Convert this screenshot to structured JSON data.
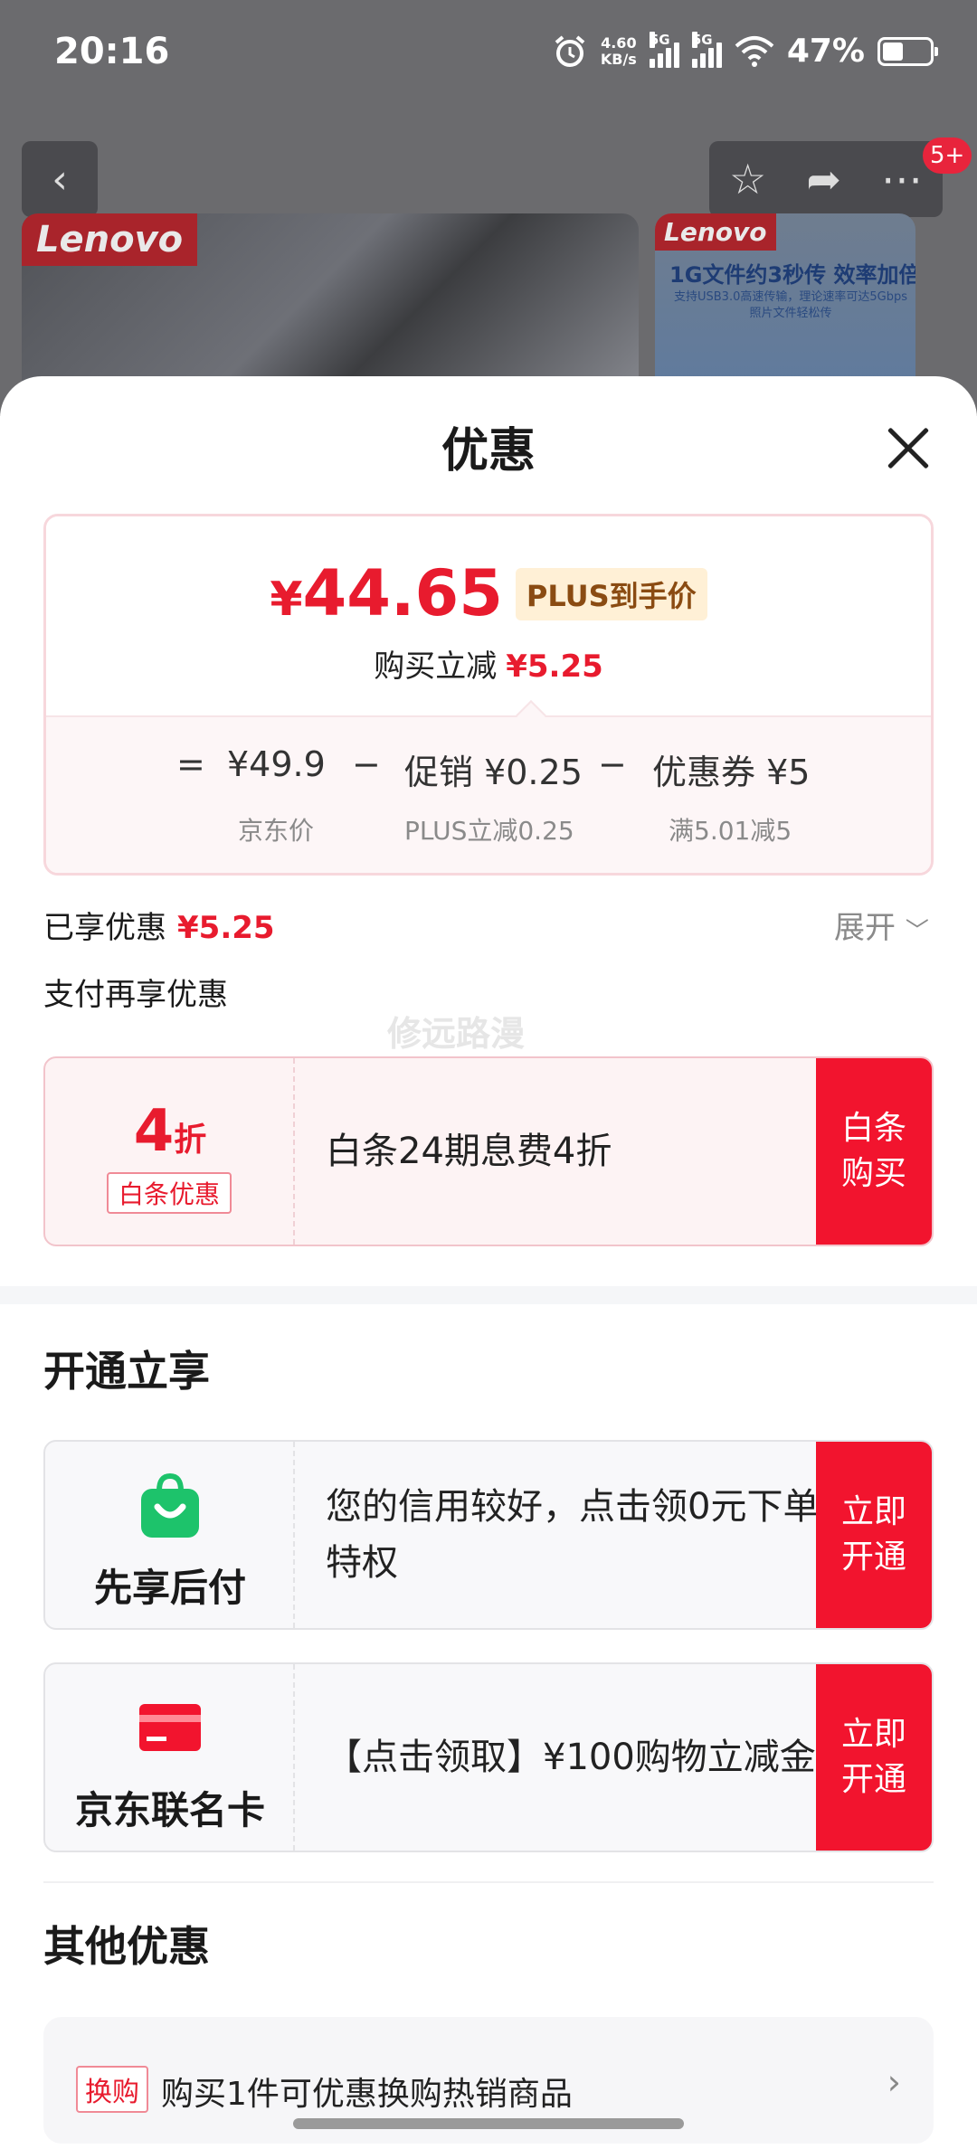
{
  "status_bar": {
    "time": "20:16",
    "net_speed_value": "4.60",
    "net_speed_unit": "KB/s",
    "sim1": "5G",
    "sim2": "5G",
    "battery": "47%"
  },
  "background_page": {
    "badge_count": "5+",
    "thumb1_brand": "Lenovo",
    "thumb2_brand": "Lenovo",
    "thumb2_title": "1G文件约3秒传 效率加倍",
    "thumb2_subtitle": "支持USB3.0高速传输，理论速率可达5Gbps 照片文件轻松传"
  },
  "sheet": {
    "title": "优惠",
    "price_summary": {
      "currency": "¥",
      "final_price": "44.65",
      "plus_tag": "PLUS到手价",
      "reduce_label": "购买立减",
      "reduce_amount": "¥5.25",
      "formula": {
        "equals": "=",
        "base_price": "¥49.9",
        "minus1": "−",
        "promo": "促销 ¥0.25",
        "minus2": "−",
        "coupon": "优惠券 ¥5",
        "base_caption": "京东价",
        "promo_caption": "PLUS立减0.25",
        "coupon_caption": "满5.01减5"
      }
    },
    "enjoyed_label": "已享优惠",
    "enjoyed_amount": "¥5.25",
    "expand_label": "展开",
    "pay_more_label": "支付再享优惠",
    "watermark": "修远路漫",
    "baitiao": {
      "discount_number": "4",
      "discount_unit": "折",
      "tag": "白条优惠",
      "description": "白条24期息费4折",
      "button_line1": "白条",
      "button_line2": "购买"
    },
    "open_section_title": "开通立享",
    "open_items": [
      {
        "label": "先享后付",
        "description": "您的信用较好，点击领0元下单特权",
        "button_line1": "立即",
        "button_line2": "开通",
        "icon": "shopping-bag-icon"
      },
      {
        "label": "京东联名卡",
        "description": "【点击领取】¥100购物立减金",
        "button_line1": "立即",
        "button_line2": "开通",
        "icon": "credit-card-icon"
      }
    ],
    "other_section_title": "其他优惠",
    "other_items": [
      {
        "tag": "换购",
        "text": "购买1件可优惠换购热销商品"
      }
    ]
  },
  "colors": {
    "accent_red": "#e81b2e",
    "button_red": "#f2142e",
    "plus_gold": "#8a4b12",
    "green_icon": "#1dc36b"
  }
}
